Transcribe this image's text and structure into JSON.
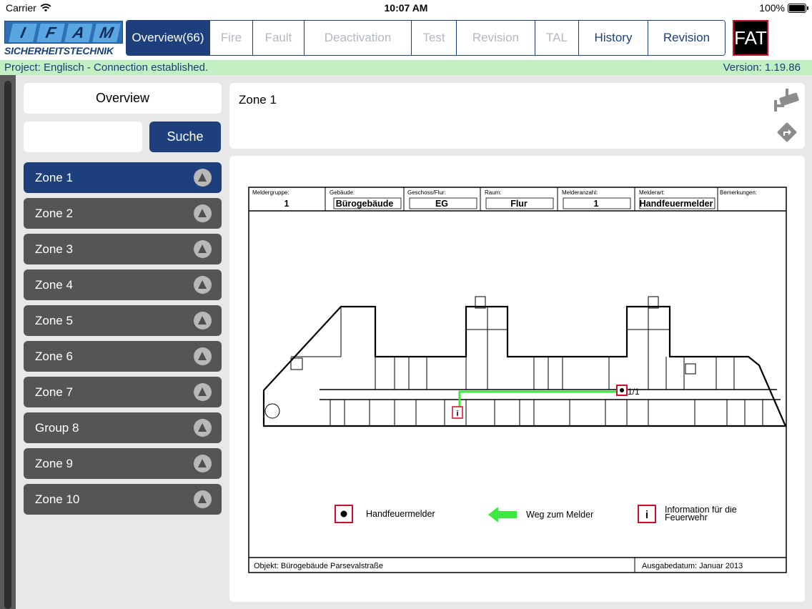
{
  "status": {
    "carrier": "Carrier",
    "time": "10:07 AM",
    "battery": "100%"
  },
  "logo": {
    "letters": [
      "I",
      "F",
      "A",
      "M"
    ],
    "subtitle": "SICHERHEITSTECHNIK"
  },
  "tabs": [
    {
      "label": "Overview(66)",
      "state": "active"
    },
    {
      "label": "Fire",
      "state": "disabled"
    },
    {
      "label": "Fault",
      "state": "disabled"
    },
    {
      "label": "Deactivation",
      "state": "disabled"
    },
    {
      "label": "Test",
      "state": "disabled"
    },
    {
      "label": "Revision",
      "state": "disabled"
    },
    {
      "label": "TAL",
      "state": "disabled"
    },
    {
      "label": "History",
      "state": "enabled"
    },
    {
      "label": "Revision",
      "state": "enabled"
    }
  ],
  "fat_label": "FAT",
  "infobar": {
    "project": "Project:  Englisch  -  Connection established.",
    "version": "Version: 1.19.86"
  },
  "sidebar": {
    "title": "Overview",
    "search_placeholder": "",
    "search_button": "Suche",
    "items": [
      {
        "label": "Zone 1",
        "active": true
      },
      {
        "label": "Zone 2"
      },
      {
        "label": "Zone 3"
      },
      {
        "label": "Zone 4"
      },
      {
        "label": "Zone 5"
      },
      {
        "label": "Zone 6"
      },
      {
        "label": "Zone 7"
      },
      {
        "label": "Group 8"
      },
      {
        "label": "Zone 9"
      },
      {
        "label": "Zone 10"
      }
    ]
  },
  "detail": {
    "title": "Zone 1",
    "icons": [
      "camera-icon",
      "directions-icon"
    ]
  },
  "plan": {
    "header": [
      {
        "label": "Meldergruppe:",
        "value": "1"
      },
      {
        "label": "Gebäude:",
        "value": "Bürogebäude"
      },
      {
        "label": "Geschoss/Flur:",
        "value": "EG"
      },
      {
        "label": "Raum:",
        "value": "Flur"
      },
      {
        "label": "Melderanzahl:",
        "value": "1"
      },
      {
        "label": "Melderart:",
        "value": "Handfeuermelder"
      },
      {
        "label": "Bemerkungen:",
        "value": ""
      }
    ],
    "marker_label": "1/1",
    "legend": [
      {
        "symbol": "manual-call-point-icon",
        "text": "Handfeuermelder"
      },
      {
        "symbol": "green-arrow-icon",
        "text": "Weg zum Melder"
      },
      {
        "symbol": "info-icon",
        "text": "Information für die Feuerwehr"
      }
    ],
    "footer_object": "Objekt: Bürogebäude Parsevalstraße",
    "footer_date": "Ausgabedatum: Januar 2013"
  },
  "colors": {
    "navy": "#1d3f7c",
    "infobar": "#c3f0c3",
    "zone_item": "#555555",
    "alarm_red": "#c8102e",
    "route_green": "#2ee82e"
  }
}
